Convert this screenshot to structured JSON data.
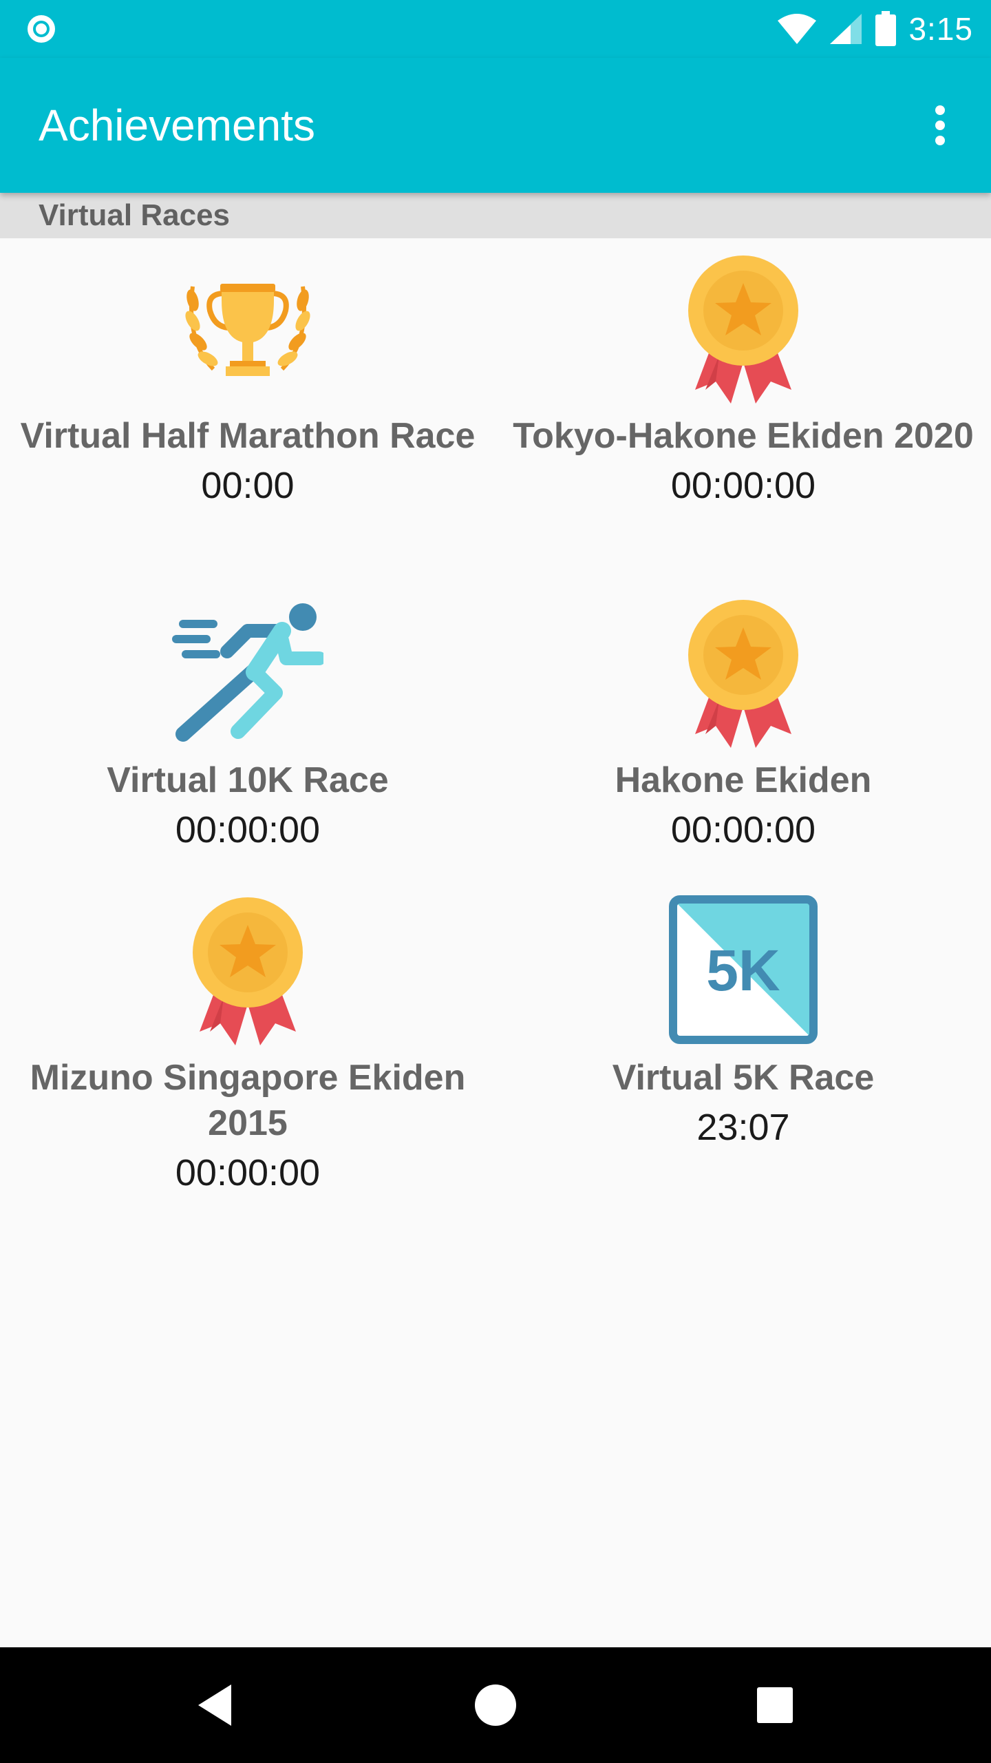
{
  "status_bar": {
    "time": "3:15",
    "icons": [
      "app-notification-icon",
      "wifi-icon",
      "cell-signal-icon",
      "battery-icon"
    ]
  },
  "app_bar": {
    "title": "Achievements",
    "menu_icon": "overflow-menu-icon"
  },
  "section": {
    "title": "Virtual Races"
  },
  "races": [
    {
      "name": "Virtual Half Marathon Race",
      "time": "00:00",
      "icon": "trophy-icon"
    },
    {
      "name": "Tokyo-Hakone Ekiden 2020",
      "time": "00:00:00",
      "icon": "medal-icon"
    },
    {
      "name": "Virtual 10K Race",
      "time": "00:00:00",
      "icon": "runner-icon"
    },
    {
      "name": "Hakone Ekiden",
      "time": "00:00:00",
      "icon": "medal-icon"
    },
    {
      "name": "Mizuno Singapore Ekiden 2015",
      "time": "00:00:00",
      "icon": "medal-icon"
    },
    {
      "name": "Virtual 5K Race",
      "time": "23:07",
      "icon": "5k-badge-icon",
      "icon_text": "5K"
    }
  ],
  "nav_bar": {
    "buttons": [
      "back-icon",
      "home-icon",
      "recents-icon"
    ]
  },
  "colors": {
    "primary": "#00bccf",
    "section_header": "#e0e0e0",
    "background": "#fafafa",
    "race_name": "#666666",
    "race_time": "#1a1a1a",
    "gold": "#fbc34a",
    "star": "#f29c1f",
    "ribbon": "#e64c54",
    "runner_dark": "#428bb2",
    "runner_light": "#6fd6e1"
  }
}
